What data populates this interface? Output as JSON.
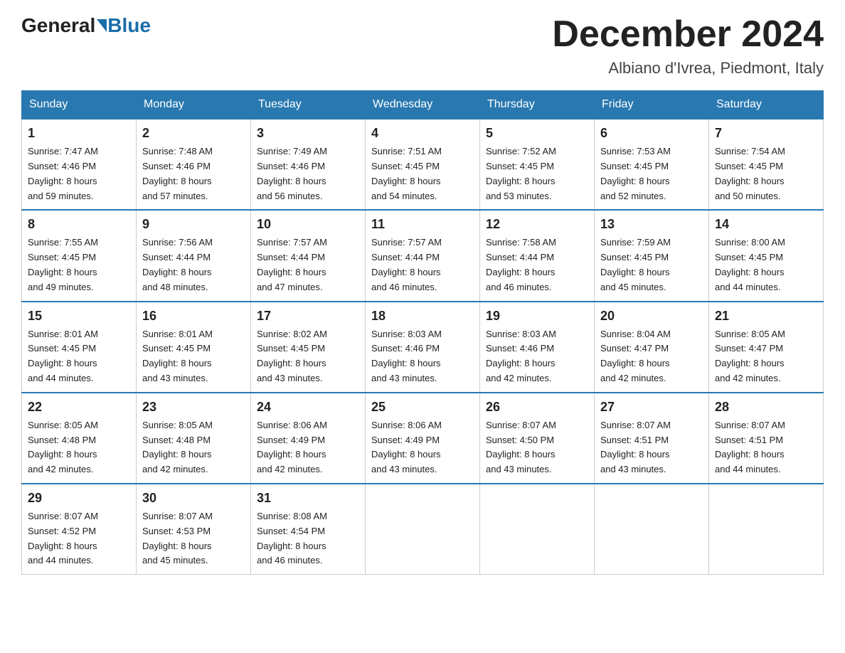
{
  "header": {
    "logo_general": "General",
    "logo_blue": "Blue",
    "month_title": "December 2024",
    "location": "Albiano d'Ivrea, Piedmont, Italy"
  },
  "days_of_week": [
    "Sunday",
    "Monday",
    "Tuesday",
    "Wednesday",
    "Thursday",
    "Friday",
    "Saturday"
  ],
  "weeks": [
    [
      {
        "day": "1",
        "sunrise": "7:47 AM",
        "sunset": "4:46 PM",
        "daylight": "8 hours and 59 minutes."
      },
      {
        "day": "2",
        "sunrise": "7:48 AM",
        "sunset": "4:46 PM",
        "daylight": "8 hours and 57 minutes."
      },
      {
        "day": "3",
        "sunrise": "7:49 AM",
        "sunset": "4:46 PM",
        "daylight": "8 hours and 56 minutes."
      },
      {
        "day": "4",
        "sunrise": "7:51 AM",
        "sunset": "4:45 PM",
        "daylight": "8 hours and 54 minutes."
      },
      {
        "day": "5",
        "sunrise": "7:52 AM",
        "sunset": "4:45 PM",
        "daylight": "8 hours and 53 minutes."
      },
      {
        "day": "6",
        "sunrise": "7:53 AM",
        "sunset": "4:45 PM",
        "daylight": "8 hours and 52 minutes."
      },
      {
        "day": "7",
        "sunrise": "7:54 AM",
        "sunset": "4:45 PM",
        "daylight": "8 hours and 50 minutes."
      }
    ],
    [
      {
        "day": "8",
        "sunrise": "7:55 AM",
        "sunset": "4:45 PM",
        "daylight": "8 hours and 49 minutes."
      },
      {
        "day": "9",
        "sunrise": "7:56 AM",
        "sunset": "4:44 PM",
        "daylight": "8 hours and 48 minutes."
      },
      {
        "day": "10",
        "sunrise": "7:57 AM",
        "sunset": "4:44 PM",
        "daylight": "8 hours and 47 minutes."
      },
      {
        "day": "11",
        "sunrise": "7:57 AM",
        "sunset": "4:44 PM",
        "daylight": "8 hours and 46 minutes."
      },
      {
        "day": "12",
        "sunrise": "7:58 AM",
        "sunset": "4:44 PM",
        "daylight": "8 hours and 46 minutes."
      },
      {
        "day": "13",
        "sunrise": "7:59 AM",
        "sunset": "4:45 PM",
        "daylight": "8 hours and 45 minutes."
      },
      {
        "day": "14",
        "sunrise": "8:00 AM",
        "sunset": "4:45 PM",
        "daylight": "8 hours and 44 minutes."
      }
    ],
    [
      {
        "day": "15",
        "sunrise": "8:01 AM",
        "sunset": "4:45 PM",
        "daylight": "8 hours and 44 minutes."
      },
      {
        "day": "16",
        "sunrise": "8:01 AM",
        "sunset": "4:45 PM",
        "daylight": "8 hours and 43 minutes."
      },
      {
        "day": "17",
        "sunrise": "8:02 AM",
        "sunset": "4:45 PM",
        "daylight": "8 hours and 43 minutes."
      },
      {
        "day": "18",
        "sunrise": "8:03 AM",
        "sunset": "4:46 PM",
        "daylight": "8 hours and 43 minutes."
      },
      {
        "day": "19",
        "sunrise": "8:03 AM",
        "sunset": "4:46 PM",
        "daylight": "8 hours and 42 minutes."
      },
      {
        "day": "20",
        "sunrise": "8:04 AM",
        "sunset": "4:47 PM",
        "daylight": "8 hours and 42 minutes."
      },
      {
        "day": "21",
        "sunrise": "8:05 AM",
        "sunset": "4:47 PM",
        "daylight": "8 hours and 42 minutes."
      }
    ],
    [
      {
        "day": "22",
        "sunrise": "8:05 AM",
        "sunset": "4:48 PM",
        "daylight": "8 hours and 42 minutes."
      },
      {
        "day": "23",
        "sunrise": "8:05 AM",
        "sunset": "4:48 PM",
        "daylight": "8 hours and 42 minutes."
      },
      {
        "day": "24",
        "sunrise": "8:06 AM",
        "sunset": "4:49 PM",
        "daylight": "8 hours and 42 minutes."
      },
      {
        "day": "25",
        "sunrise": "8:06 AM",
        "sunset": "4:49 PM",
        "daylight": "8 hours and 43 minutes."
      },
      {
        "day": "26",
        "sunrise": "8:07 AM",
        "sunset": "4:50 PM",
        "daylight": "8 hours and 43 minutes."
      },
      {
        "day": "27",
        "sunrise": "8:07 AM",
        "sunset": "4:51 PM",
        "daylight": "8 hours and 43 minutes."
      },
      {
        "day": "28",
        "sunrise": "8:07 AM",
        "sunset": "4:51 PM",
        "daylight": "8 hours and 44 minutes."
      }
    ],
    [
      {
        "day": "29",
        "sunrise": "8:07 AM",
        "sunset": "4:52 PM",
        "daylight": "8 hours and 44 minutes."
      },
      {
        "day": "30",
        "sunrise": "8:07 AM",
        "sunset": "4:53 PM",
        "daylight": "8 hours and 45 minutes."
      },
      {
        "day": "31",
        "sunrise": "8:08 AM",
        "sunset": "4:54 PM",
        "daylight": "8 hours and 46 minutes."
      },
      null,
      null,
      null,
      null
    ]
  ],
  "labels": {
    "sunrise": "Sunrise:",
    "sunset": "Sunset:",
    "daylight": "Daylight:"
  }
}
